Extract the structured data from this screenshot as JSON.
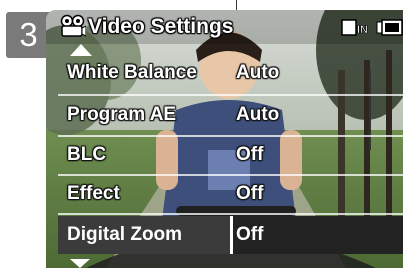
{
  "step_number": "3",
  "header": {
    "icon": "video-camera-icon",
    "title": "Video Settings",
    "status_icons": [
      "memory-in-icon",
      "battery-icon"
    ]
  },
  "menu": {
    "items": [
      {
        "label": "White Balance",
        "value": "Auto",
        "selected": false
      },
      {
        "label": "Program AE",
        "value": "Auto",
        "selected": false
      },
      {
        "label": "BLC",
        "value": "Off",
        "selected": false
      },
      {
        "label": "Effect",
        "value": "Off",
        "selected": false
      },
      {
        "label": "Digital Zoom",
        "value": "Off",
        "selected": true
      }
    ],
    "scroll_up_icon": "arrow-up-icon",
    "scroll_down_icon": "arrow-down-icon"
  },
  "colors": {
    "step_tab": "#7a7a7a",
    "selected_row": "#3b3b3b",
    "selected_value": "#222222",
    "text": "#ffffff"
  }
}
